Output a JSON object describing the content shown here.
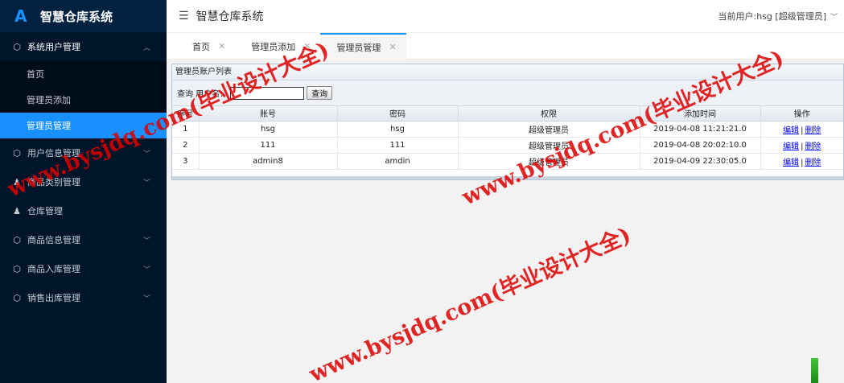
{
  "app": {
    "logo_letter": "A",
    "title": "智慧仓库系统"
  },
  "sidebar": {
    "groups": [
      {
        "label": "系统用户管理",
        "icon": "cube-icon",
        "expanded": true,
        "children": [
          {
            "label": "首页"
          },
          {
            "label": "管理员添加"
          },
          {
            "label": "管理员管理",
            "active": true
          }
        ]
      },
      {
        "label": "用户信息管理",
        "icon": "cube-icon"
      },
      {
        "label": "商品类别管理",
        "icon": "user-icon"
      },
      {
        "label": "仓库管理",
        "icon": "user-icon"
      },
      {
        "label": "商品信息管理",
        "icon": "cube-icon"
      },
      {
        "label": "商品入库管理",
        "icon": "cube-icon"
      },
      {
        "label": "销售出库管理",
        "icon": "cube-icon"
      }
    ]
  },
  "header": {
    "title": "智慧仓库系统",
    "current_user": "当前用户:hsg [超级管理员]"
  },
  "tabs": [
    {
      "label": "首页"
    },
    {
      "label": "管理员添加"
    },
    {
      "label": "管理员管理",
      "active": true
    }
  ],
  "panel": {
    "title": "管理员账户列表",
    "search_label": "查询 用户名：",
    "search_value": "",
    "search_button": "查询",
    "columns": [
      "序号",
      "账号",
      "密码",
      "权限",
      "添加时间",
      "操作"
    ],
    "rows": [
      {
        "idx": "1",
        "account": "hsg",
        "password": "hsg",
        "role": "超级管理员",
        "time": "2019-04-08 11:21:21.0"
      },
      {
        "idx": "2",
        "account": "111",
        "password": "111",
        "role": "超级管理员",
        "time": "2019-04-08 20:02:10.0"
      },
      {
        "idx": "3",
        "account": "admin8",
        "password": "amdin",
        "role": "超级管理员",
        "time": "2019-04-09 22:30:05.0"
      }
    ],
    "op_edit": "编辑",
    "op_sep": "|",
    "op_delete": "删除"
  },
  "watermark": {
    "text_1": "www.bysjdq.com(毕业设计大全)",
    "text_2": "www.bysjdq.com(毕业设计大全)",
    "text_3": "www.bysjdq.com(毕业设计大全)",
    "color": "#dc0000"
  }
}
